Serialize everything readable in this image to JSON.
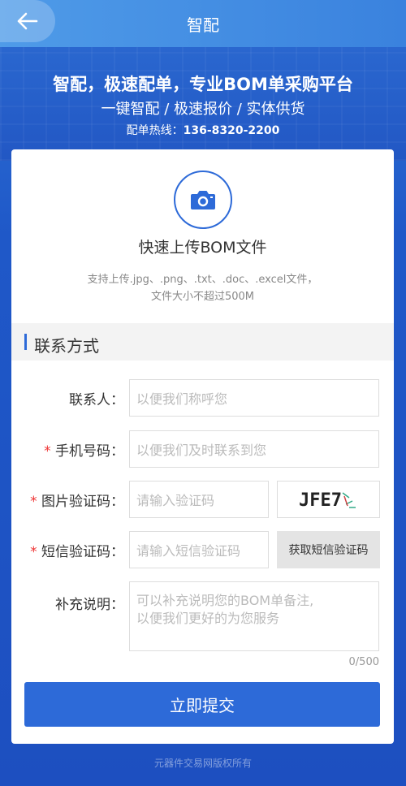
{
  "header": {
    "title": "智配"
  },
  "banner": {
    "headline": "智配，极速配单，专业BOM单采购平台",
    "subline": "一键智配 / 极速报价 / 实体供货",
    "hotline_label": "配单热线：",
    "hotline_number": "136-8320-2200"
  },
  "upload": {
    "title": "快速上传BOM文件",
    "hint_line1": "支持上传.jpg、.png、.txt、.doc、.excel文件，",
    "hint_line2": "文件大小不超过500M"
  },
  "contact": {
    "section_title": "联系方式",
    "required_mark": "*",
    "name_label": "联系人：",
    "name_placeholder": "以便我们称呼您",
    "phone_label": "手机号码：",
    "phone_placeholder": "以便我们及时联系到您",
    "captcha_label": "图片验证码：",
    "captcha_placeholder": "请输入验证码",
    "captcha_text": "JFE7",
    "sms_label": "短信验证码：",
    "sms_placeholder": "请输入短信验证码",
    "sms_button": "获取短信验证码",
    "note_label": "补充说明：",
    "note_placeholder_line1": "可以补充说明您的BOM单备注,",
    "note_placeholder_line2": "以便我们更好的为您服务",
    "note_counter": "0/500"
  },
  "submit_label": "立即提交",
  "footer": "元器件交易网版权所有",
  "colors": {
    "primary": "#2d6ad8",
    "required": "#e33333",
    "background": "#1d4fc0"
  },
  "icons": {
    "back": "arrow-left-icon",
    "upload": "camera-icon"
  }
}
